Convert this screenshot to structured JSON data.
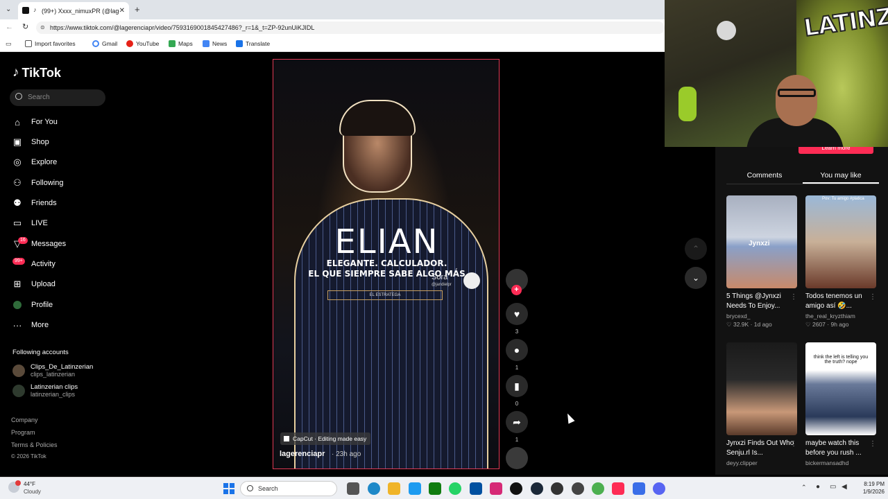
{
  "browser": {
    "tab_title": "(99+) Xxxx_nimuxPR (@lagere",
    "url": "https://www.tiktok.com/@lagerenciapr/video/7593169001845427486?_r=1&_t=ZP-92unUiKJIDL",
    "bookmarks": [
      "Import favorites",
      "Gmail",
      "YouTube",
      "Maps",
      "News",
      "Translate"
    ]
  },
  "sidebar": {
    "logo": "TikTok",
    "search_placeholder": "Search",
    "nav": [
      {
        "label": "For You",
        "icon": "home-icon"
      },
      {
        "label": "Shop",
        "icon": "shop-icon"
      },
      {
        "label": "Explore",
        "icon": "compass-icon"
      },
      {
        "label": "Following",
        "icon": "following-icon"
      },
      {
        "label": "Friends",
        "icon": "friends-icon"
      },
      {
        "label": "LIVE",
        "icon": "live-icon"
      },
      {
        "label": "Messages",
        "icon": "messages-icon",
        "badge": "16"
      },
      {
        "label": "Activity",
        "icon": "activity-icon",
        "badge": "99+"
      },
      {
        "label": "Upload",
        "icon": "upload-icon"
      },
      {
        "label": "Profile",
        "icon": "profile-icon"
      },
      {
        "label": "More",
        "icon": "more-icon"
      }
    ],
    "following_title": "Following accounts",
    "following": [
      {
        "name": "Clips_De_Latinzerian",
        "username": "clips_latinzerian"
      },
      {
        "name": "Latinzerian clips",
        "username": "latinzerian_clips"
      }
    ],
    "footer": [
      "Company",
      "Program",
      "Terms & Policies",
      "© 2026 TikTok"
    ]
  },
  "video": {
    "title": "ELIAN",
    "subtitle1": "ELEGANTE. CALCULADOR.",
    "subtitle2": "EL QUE SIEMPRE SABE ALGO MÁS",
    "sora": "Sora",
    "sora_handle": "@jandielpr",
    "box_label": "EL ESTRATEGA",
    "capcut": "CapCut · Editing made easy",
    "author": "lagerenciapr",
    "time": "· 23h ago"
  },
  "actions": {
    "likes": "3",
    "comments": "1",
    "saves": "0",
    "shares": "1"
  },
  "right_panel": {
    "tab_comments": "Comments",
    "tab_you_may_like": "You may like",
    "learn_more": "Learn more",
    "cards": [
      {
        "title": "5 Things @Jynxzi Needs To Enjoy...",
        "user": "brycexd_",
        "likes": "32.9K",
        "ago": "1d ago",
        "overlay": "Jynxzi"
      },
      {
        "title": "Todos tenemos un amigo así 🤣...",
        "user": "the_real_kryzthiam",
        "likes": "2607",
        "ago": "9h ago",
        "overlay": "Pov: Tu amigo #platica"
      },
      {
        "title": "Jynxzi Finds Out Who Senju.rl Is...",
        "user": "deyy.clipper",
        "likes": "",
        "ago": "",
        "overlay": ""
      },
      {
        "title": "maybe watch this before you rush ...",
        "user": "bickermansadhd",
        "likes": "",
        "ago": "",
        "overlay": "think the left is telling you the truth? nope"
      }
    ]
  },
  "webcam": {
    "overlay_text": "LATINZER!"
  },
  "taskbar": {
    "temp": "44°F",
    "weather": "Cloudy",
    "search": "Search",
    "time": "8:19 PM",
    "date": "1/9/2026"
  }
}
